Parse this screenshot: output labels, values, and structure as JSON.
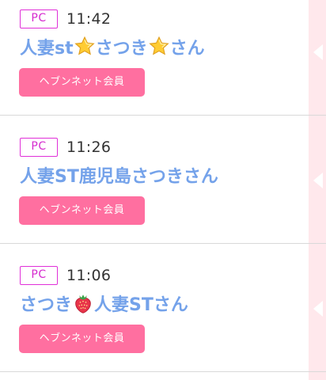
{
  "entries": [
    {
      "badge": "PC",
      "time": "11:42",
      "name_parts": [
        "人妻st",
        "star",
        "さつき",
        "star",
        "さん"
      ],
      "name": {
        "p0": "人妻st",
        "p1": "さつき",
        "p2": "さん"
      },
      "button_label": "ヘブンネット会員"
    },
    {
      "badge": "PC",
      "time": "11:26",
      "name": {
        "p0": "人妻ST鹿児島さつきさん"
      },
      "button_label": "ヘブンネット会員"
    },
    {
      "badge": "PC",
      "time": "11:06",
      "name": {
        "p0": "さつき",
        "p1": "人妻STさん"
      },
      "button_label": "ヘブンネット会員"
    }
  ],
  "icons": {
    "entry_0_emoji_1": "star-icon",
    "entry_0_emoji_2": "star-icon",
    "entry_2_emoji_1": "strawberry-icon",
    "side_arrow": "chevron-left-icon"
  },
  "colors": {
    "name_text": "#74a2ea",
    "badge_border": "#e030d8",
    "button_bg": "#ff6fa0",
    "side_rail_bg": "#ffe8ec",
    "divider": "#d9d9d9"
  }
}
